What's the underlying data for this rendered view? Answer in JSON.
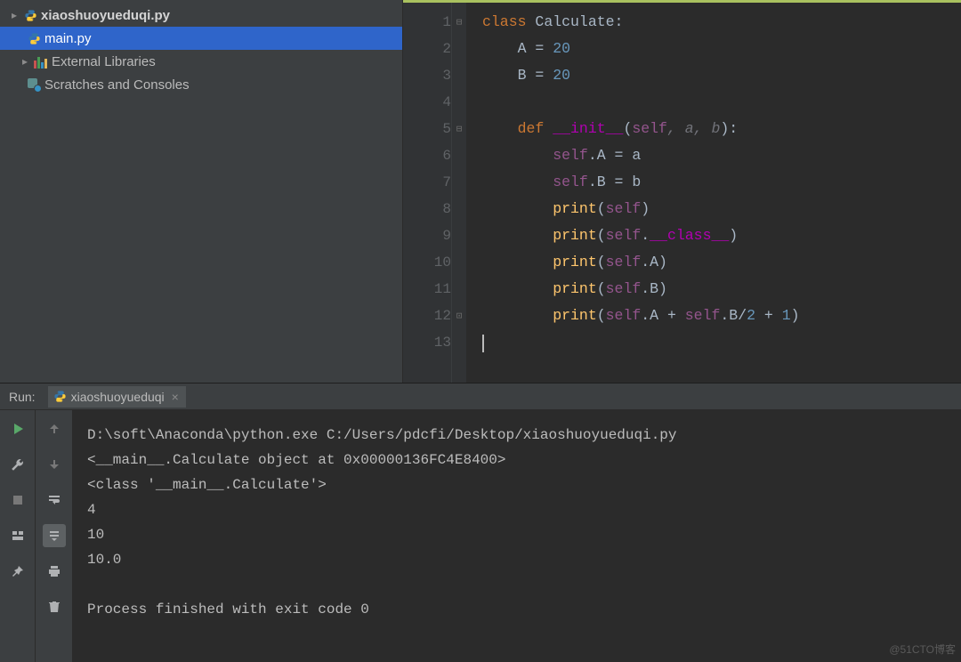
{
  "tree": {
    "items": [
      {
        "label": "xiaoshuoyueduqi.py",
        "icon": "python-file-icon",
        "expandable": true
      },
      {
        "label": "main.py",
        "icon": "python-file-icon",
        "selected": true
      },
      {
        "label": "External Libraries",
        "icon": "libraries-icon",
        "expandable": true
      },
      {
        "label": "Scratches and Consoles",
        "icon": "scratches-icon"
      }
    ]
  },
  "editor": {
    "language": "python",
    "lines": [
      {
        "num": "1",
        "text": "class Calculate:"
      },
      {
        "num": "2",
        "text": "    A = 20"
      },
      {
        "num": "3",
        "text": "    B = 20"
      },
      {
        "num": "4",
        "text": ""
      },
      {
        "num": "5",
        "text": "    def __init__(self, a, b):"
      },
      {
        "num": "6",
        "text": "        self.A = a"
      },
      {
        "num": "7",
        "text": "        self.B = b"
      },
      {
        "num": "8",
        "text": "        print(self)"
      },
      {
        "num": "9",
        "text": "        print(self.__class__)"
      },
      {
        "num": "10",
        "text": "        print(self.A)"
      },
      {
        "num": "11",
        "text": "        print(self.B)"
      },
      {
        "num": "12",
        "text": "        print(self.A + self.B/2 + 1)"
      },
      {
        "num": "13",
        "text": ""
      }
    ]
  },
  "run": {
    "title": "Run:",
    "tab": "xiaoshuoyueduqi",
    "output": [
      "D:\\soft\\Anaconda\\python.exe C:/Users/pdcfi/Desktop/xiaoshuoyueduqi.py",
      "<__main__.Calculate object at 0x00000136FC4E8400>",
      "<class '__main__.Calculate'>",
      "4",
      "10",
      "10.0",
      "",
      "Process finished with exit code 0"
    ]
  },
  "watermark": "@51CTO博客"
}
